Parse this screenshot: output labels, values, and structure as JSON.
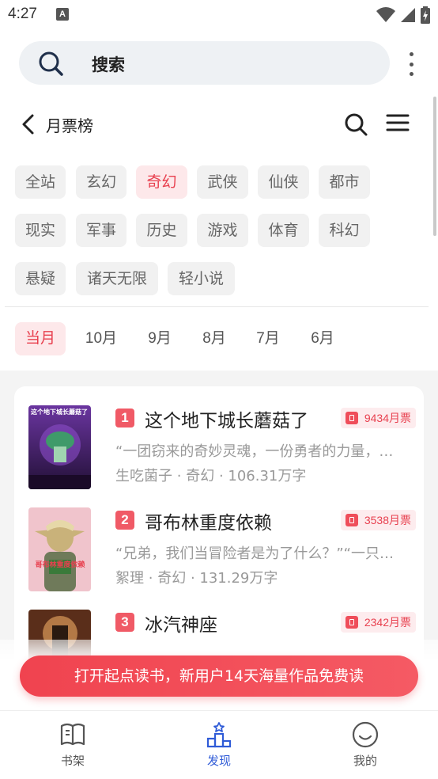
{
  "status_bar": {
    "time": "4:27",
    "notification_glyph": "A"
  },
  "search": {
    "placeholder": "搜索"
  },
  "header": {
    "title": "月票榜"
  },
  "categories": [
    "全站",
    "玄幻",
    "奇幻",
    "武侠",
    "仙侠",
    "都市",
    "现实",
    "军事",
    "历史",
    "游戏",
    "体育",
    "科幻",
    "悬疑",
    "诸天无限",
    "轻小说"
  ],
  "selected_category": "奇幻",
  "months": [
    "当月",
    "10月",
    "9月",
    "8月",
    "7月",
    "6月"
  ],
  "selected_month": "当月",
  "books": [
    {
      "rank": "1",
      "title": "这个地下城长蘑菇了",
      "votes": "9434月票",
      "desc": "“一团窃来的奇妙灵魂，一份勇者的力量，…",
      "author": "生吃菌子",
      "genre": "奇幻",
      "words": "106.31万字",
      "cover_text": "这个地下城长蘑菇了",
      "cover_colors": [
        "#5a2a8a",
        "#2b1245"
      ]
    },
    {
      "rank": "2",
      "title": "哥布林重度依赖",
      "votes": "3538月票",
      "desc": "“兄弟，我们当冒险者是为了什么？”“一只…",
      "author": "絮理",
      "genre": "奇幻",
      "words": "131.29万字",
      "cover_text": "哥布林重度依赖",
      "cover_colors": [
        "#f2c8cf",
        "#e8aeb8"
      ]
    },
    {
      "rank": "3",
      "title": "冰汽神座",
      "votes": "2342月票",
      "desc": "",
      "author": "",
      "genre": "",
      "words": "",
      "cover_text": "",
      "cover_colors": [
        "#b0643a",
        "#5a2e1a"
      ]
    }
  ],
  "meta_separator": "·",
  "promo": {
    "label": "打开起点读书，新用户14天海量作品免费读"
  },
  "bottom_nav": [
    {
      "label": "书架",
      "icon": "book-icon"
    },
    {
      "label": "发现",
      "icon": "podium-icon"
    },
    {
      "label": "我的",
      "icon": "smile-icon"
    }
  ],
  "active_nav": "发现",
  "colors": {
    "accent": "#e8404f",
    "accent_bg": "#fde8ea",
    "nav_active": "#2f5bd7"
  }
}
